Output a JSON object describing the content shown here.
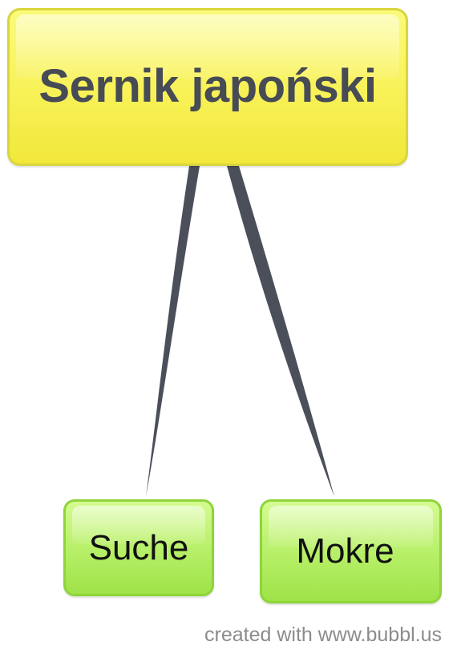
{
  "diagram": {
    "root": {
      "label": "Sernik japoński",
      "color": "#f7f35a",
      "border": "#d9d63c",
      "text_color": "#464b55"
    },
    "children": [
      {
        "label": "Suche",
        "color": "#b8f06a",
        "border": "#8fd43a"
      },
      {
        "label": "Mokre",
        "color": "#b8f06a",
        "border": "#8fd43a"
      }
    ],
    "edges": [
      {
        "from": "Sernik japoński",
        "to": "Suche"
      },
      {
        "from": "Sernik japoński",
        "to": "Mokre"
      }
    ],
    "edge_color": "#4a4f5a"
  },
  "footer": {
    "credit": "created with www.bubbl.us"
  }
}
